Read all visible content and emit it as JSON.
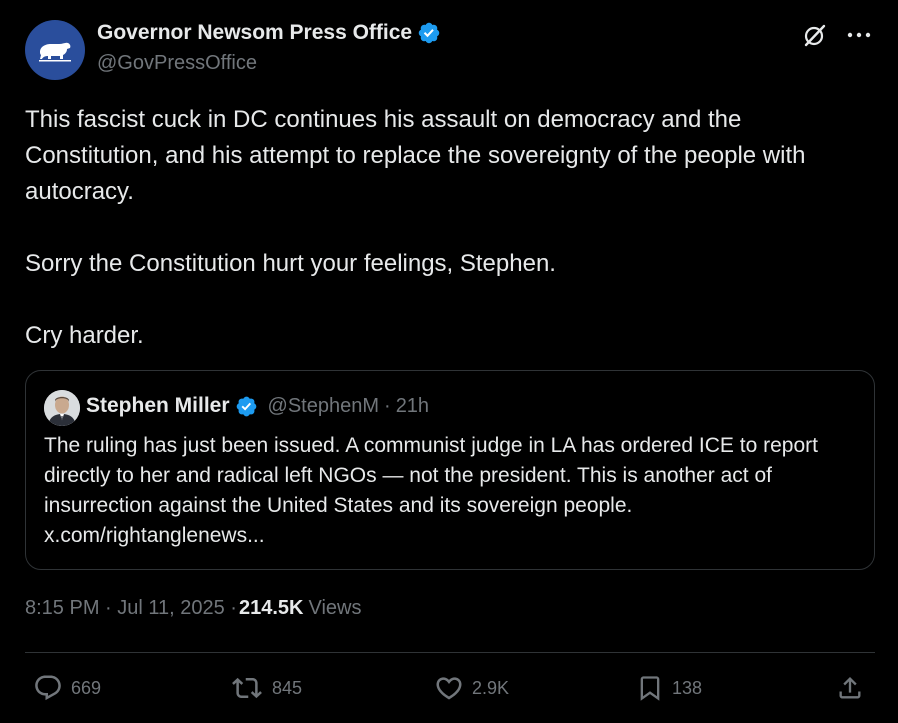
{
  "author": {
    "display_name": "Governor Newsom Press Office",
    "handle": "@GovPressOffice",
    "verified": true,
    "avatar_icon": "california-bear-icon",
    "avatar_color": "#2a4e9c"
  },
  "tweet": {
    "paragraphs": [
      "This fascist cuck in DC continues his assault on democracy and the Constitution, and his attempt to replace the sovereignty of the people with autocracy.",
      "Sorry the Constitution hurt your feelings, Stephen.",
      "Cry harder."
    ]
  },
  "quote": {
    "display_name": "Stephen Miller",
    "handle": "@StephenM",
    "separator": "·",
    "time": "21h",
    "verified": true,
    "text": "The ruling has just been issued. A communist judge in LA has ordered ICE to report directly to her and radical left NGOs — not the president. This is another act of insurrection against the United States and its sovereign people. x.com/rightanglenews..."
  },
  "meta": {
    "timestamp": "8:15 PM · Jul 11, 2025 ·",
    "views_count": "214.5K",
    "views_label": "Views"
  },
  "actions": {
    "replies": "669",
    "reposts": "845",
    "likes": "2.9K",
    "bookmarks": "138"
  },
  "colors": {
    "background": "#000000",
    "text": "#e7e9ea",
    "muted": "#71767b",
    "border": "#2f3336",
    "verified": "#1d9bf0"
  }
}
